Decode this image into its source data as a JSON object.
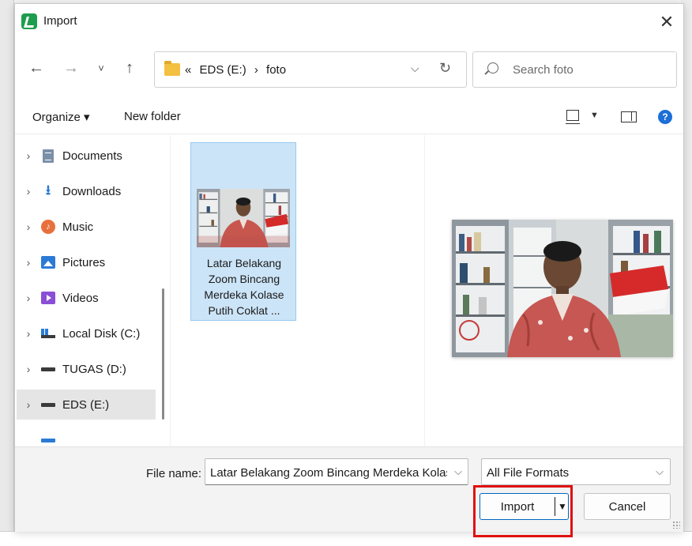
{
  "dialog": {
    "title": "Import",
    "close_glyph": "✕"
  },
  "nav": {
    "back": "←",
    "forward": "→",
    "recent": "˅",
    "up": "↑",
    "breadcrumb_prefix": "«",
    "breadcrumb": [
      "EDS (E:)",
      "›",
      "foto"
    ],
    "address_dropdown": "⌵",
    "refresh": "↻",
    "search_placeholder": "Search foto"
  },
  "toolbar": {
    "organize": "Organize ▾",
    "new_folder": "New folder",
    "view_dropdown": "▼",
    "help": "?"
  },
  "sidebar": {
    "items": [
      {
        "label": "Documents",
        "icon": "documents-icon",
        "chevron": "›"
      },
      {
        "label": "Downloads",
        "icon": "downloads-icon",
        "chevron": "›"
      },
      {
        "label": "Music",
        "icon": "music-icon",
        "chevron": "›"
      },
      {
        "label": "Pictures",
        "icon": "pictures-icon",
        "chevron": "›"
      },
      {
        "label": "Videos",
        "icon": "videos-icon",
        "chevron": "›"
      },
      {
        "label": "Local Disk (C:)",
        "icon": "local-disk-icon",
        "chevron": "›"
      },
      {
        "label": "TUGAS (D:)",
        "icon": "drive-icon",
        "chevron": "›"
      },
      {
        "label": "EDS (E:)",
        "icon": "drive-icon",
        "chevron": "›",
        "selected": true
      }
    ]
  },
  "files": [
    {
      "name": "Latar Belakang Zoom Bincang Merdeka Kolase Putih Coklat ...",
      "selected": true
    }
  ],
  "footer": {
    "file_name_label": "File name:",
    "file_name_value": "Latar Belakang Zoom Bincang Merdeka Kolas",
    "file_name_chevron": "⌵",
    "format_value": "All File Formats",
    "format_chevron": "⌵",
    "import_label": "Import",
    "import_dropdown": "▼",
    "cancel_label": "Cancel"
  },
  "colors": {
    "accent": "#0067c0",
    "selection": "#cce4f7",
    "highlight": "#e01010"
  }
}
